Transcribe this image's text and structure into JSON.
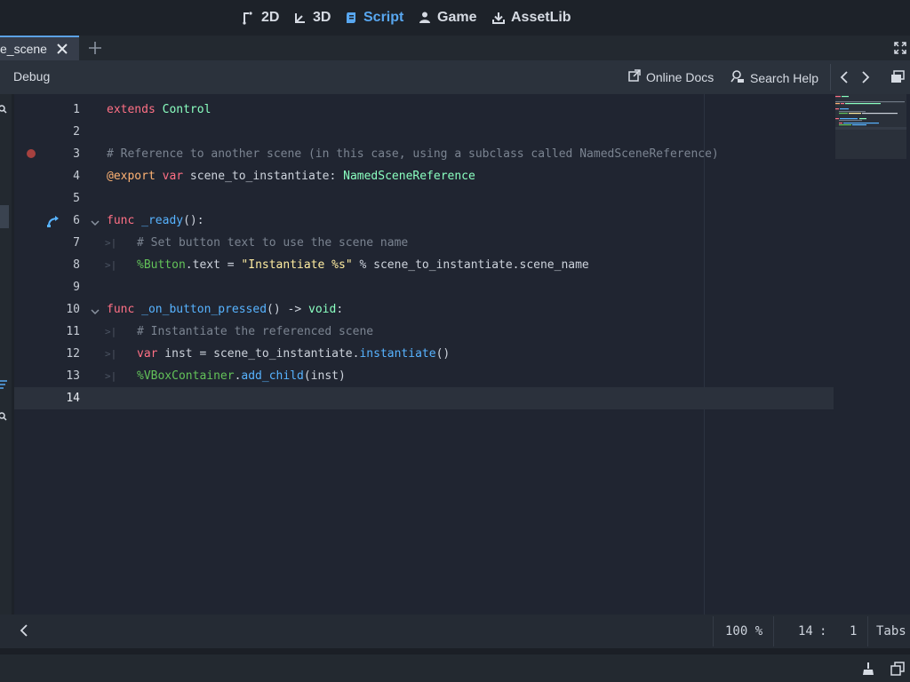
{
  "workspaces": [
    {
      "label": "2D",
      "icon": "2d-icon",
      "active": false
    },
    {
      "label": "3D",
      "icon": "3d-icon",
      "active": false
    },
    {
      "label": "Script",
      "icon": "script-icon",
      "active": true
    },
    {
      "label": "Game",
      "icon": "game-icon",
      "active": false
    },
    {
      "label": "AssetLib",
      "icon": "assetlib-icon",
      "active": false
    }
  ],
  "tabs": [
    {
      "label": "e_scene",
      "active": true
    }
  ],
  "toolbar": {
    "debug": "Debug",
    "online_docs": "Online Docs",
    "search_help": "Search Help"
  },
  "code": {
    "line_numbers": [
      "1",
      "2",
      "3",
      "4",
      "5",
      "6",
      "7",
      "8",
      "9",
      "10",
      "11",
      "12",
      "13",
      "14"
    ],
    "current_line": 14,
    "breakpoint_line": 3,
    "lines": [
      "extends Control",
      "",
      "# Reference to another scene (in this case, using a subclass called NamedSceneReference)",
      "@export var scene_to_instantiate: NamedSceneReference",
      "",
      "func _ready():",
      "# Set button text to use the scene name",
      "%Button.text = \"Instantiate %s\" % scene_to_instantiate.scene_name",
      "",
      "func _on_button_pressed() -> void:",
      "# Instantiate the referenced scene",
      "var inst = scene_to_instantiate.instantiate()",
      "%VBoxContainer.add_child(inst)",
      ""
    ]
  },
  "status": {
    "zoom": "100 %",
    "cursor_line": "14",
    "cursor_sep": ":",
    "cursor_col": "1",
    "indent": "Tabs"
  },
  "colors": {
    "accent": "#58a7f0",
    "keyword": "#ff7085",
    "type": "#8affc0",
    "comment": "#7b8491",
    "string": "#ffeda1",
    "function": "#57b3ff",
    "node_path": "#63c259",
    "annotation": "#ffb373",
    "breakpoint": "#a6413f"
  }
}
